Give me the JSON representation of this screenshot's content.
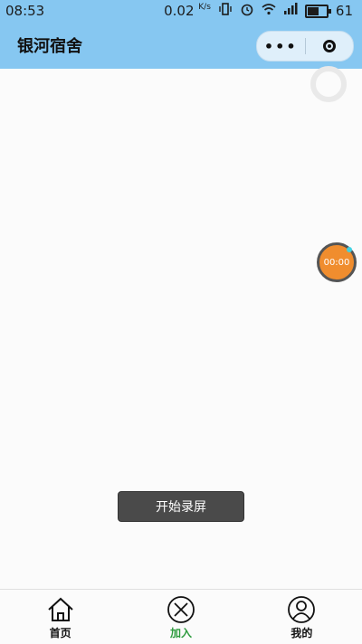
{
  "status_bar": {
    "time": "08:53",
    "network_speed": "0.02",
    "network_speed_unit": "K/s",
    "battery_level": "61",
    "battery_fraction": 0.61
  },
  "nav": {
    "title": "银河宿舍",
    "more_label": "•••"
  },
  "timer": {
    "value": "00:00"
  },
  "record_button": {
    "label": "开始录屏"
  },
  "tabs": [
    {
      "label": "首页",
      "active": false
    },
    {
      "label": "加入",
      "active": true
    },
    {
      "label": "我的",
      "active": false
    }
  ],
  "colors": {
    "nav_bg": "#86c7f1",
    "timer_bg": "#f08d2e",
    "active_tab": "#2e9b3e",
    "button_bg": "#4a4a4a"
  }
}
